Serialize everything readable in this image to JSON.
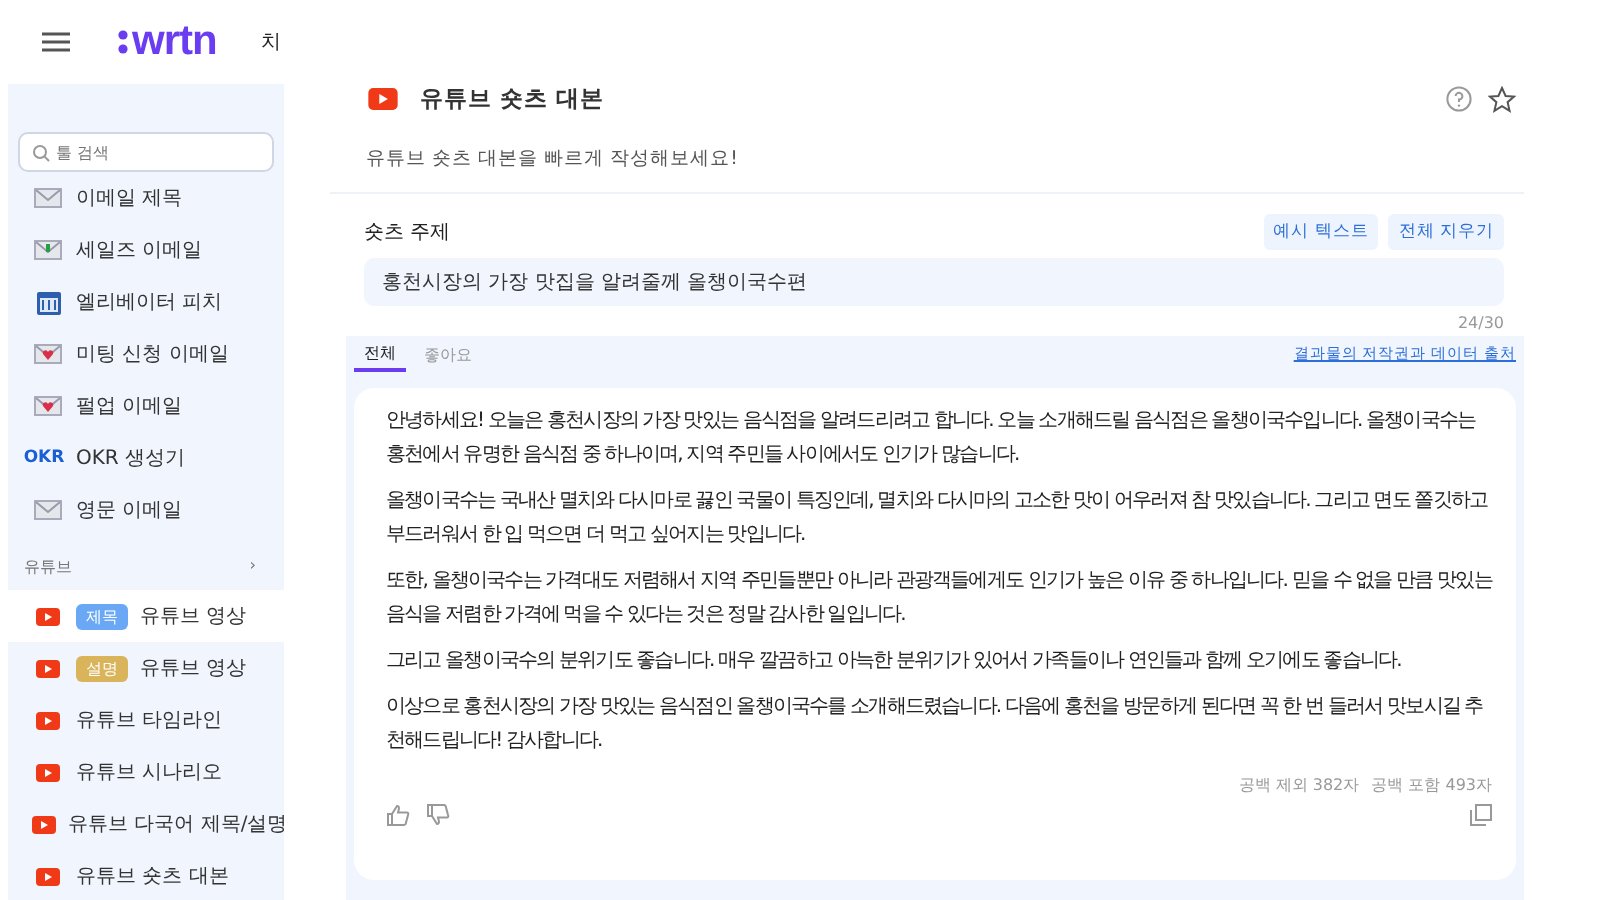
{
  "header": {
    "logo": "wrtn",
    "cut_text": "치"
  },
  "sidebar": {
    "search": {
      "placeholder": "툴 검색"
    },
    "items": [
      {
        "kind": "envelope",
        "label": "이메일 제목",
        "selected": false
      },
      {
        "kind": "envelope-green",
        "label": "세일즈 이메일",
        "selected": false
      },
      {
        "kind": "calendar",
        "label": "엘리베이터 피치",
        "selected": false
      },
      {
        "kind": "envelope-heart",
        "label": "미팅 신청 이메일",
        "selected": false
      },
      {
        "kind": "envelope-heart",
        "label": "펄업 이메일",
        "selected": false
      },
      {
        "kind": "text",
        "icon_text": "OKR",
        "label": "OKR 생성기",
        "selected": false
      },
      {
        "kind": "envelope",
        "label": "영문 이메일",
        "selected": false
      }
    ],
    "section": {
      "label": "유튜브",
      "chevron": "›"
    },
    "section_items": [
      {
        "kind": "youtube",
        "badge": {
          "label": "제목",
          "color": "#6aa8f5"
        },
        "label": "유튜브 영상",
        "selected": true
      },
      {
        "kind": "youtube",
        "badge": {
          "label": "설명",
          "color": "#d9b45a"
        },
        "label": "유튜브 영상",
        "selected": false
      },
      {
        "kind": "youtube",
        "label": "유튜브 타임라인",
        "selected": false
      },
      {
        "kind": "youtube",
        "label": "유튜브 시나리오",
        "selected": false
      },
      {
        "kind": "youtube",
        "label": "유튜브 다국어 제목/설명",
        "selected": false
      },
      {
        "kind": "youtube",
        "label": "유튜브 숏츠 대본",
        "selected": false
      }
    ]
  },
  "tool": {
    "title": "유튜브 숏츠 대본",
    "description": "유튜브 숏츠 대본을 빠르게 작성해보세요!",
    "favorite": false
  },
  "form": {
    "label": "숏츠 주제",
    "buttons": [
      "예시 텍스트",
      "전체 지우기"
    ],
    "value": "홍천시장의 가장 맛집을 알려줄께 올챙이국수편",
    "counter": "24/30"
  },
  "tabs": [
    {
      "label": "전체",
      "selected": true
    },
    {
      "label": "좋아요",
      "selected": false
    }
  ],
  "copyright_link": "결과물의 저작권과 데이터 출처",
  "result": {
    "paragraphs": [
      "안녕하세요! 오늘은 홍천시장의 가장 맛있는 음식점을 알려드리려고 합니다. 오늘 소개해드릴 음식점은 올챙이국수입니다. 올챙이국수는 홍천에서 유명한 음식점 중 하나이며, 지역 주민들 사이에서도 인기가 많습니다.",
      "올챙이국수는 국내산 멸치와 다시마로 끓인 국물이 특징인데, 멸치와 다시마의 고소한 맛이 어우러져 참 맛있습니다. 그리고 면도 쫄깃하고 부드러워서 한 입 먹으면 더 먹고 싶어지는 맛입니다.",
      "또한, 올챙이국수는 가격대도 저렴해서 지역 주민들뿐만 아니라 관광객들에게도 인기가 높은 이유 중 하나입니다. 믿을 수 없을 만큼 맛있는 음식을 저렴한 가격에 먹을 수 있다는 것은 정말 감사한 일입니다.",
      "그리고 올챙이국수의 분위기도 좋습니다. 매우 깔끔하고 아늑한 분위기가 있어서 가족들이나 연인들과 함께 오기에도 좋습니다.",
      "이상으로 홍천시장의 가장 맛있는 음식점인 올챙이국수를 소개해드렸습니다. 다음에 홍천을 방문하게 된다면 꼭 한 번 들러서 맛보시길 추천해드립니다! 감사합니다."
    ],
    "counts": [
      "공백 제외 382자",
      "공백 포함 493자"
    ]
  }
}
